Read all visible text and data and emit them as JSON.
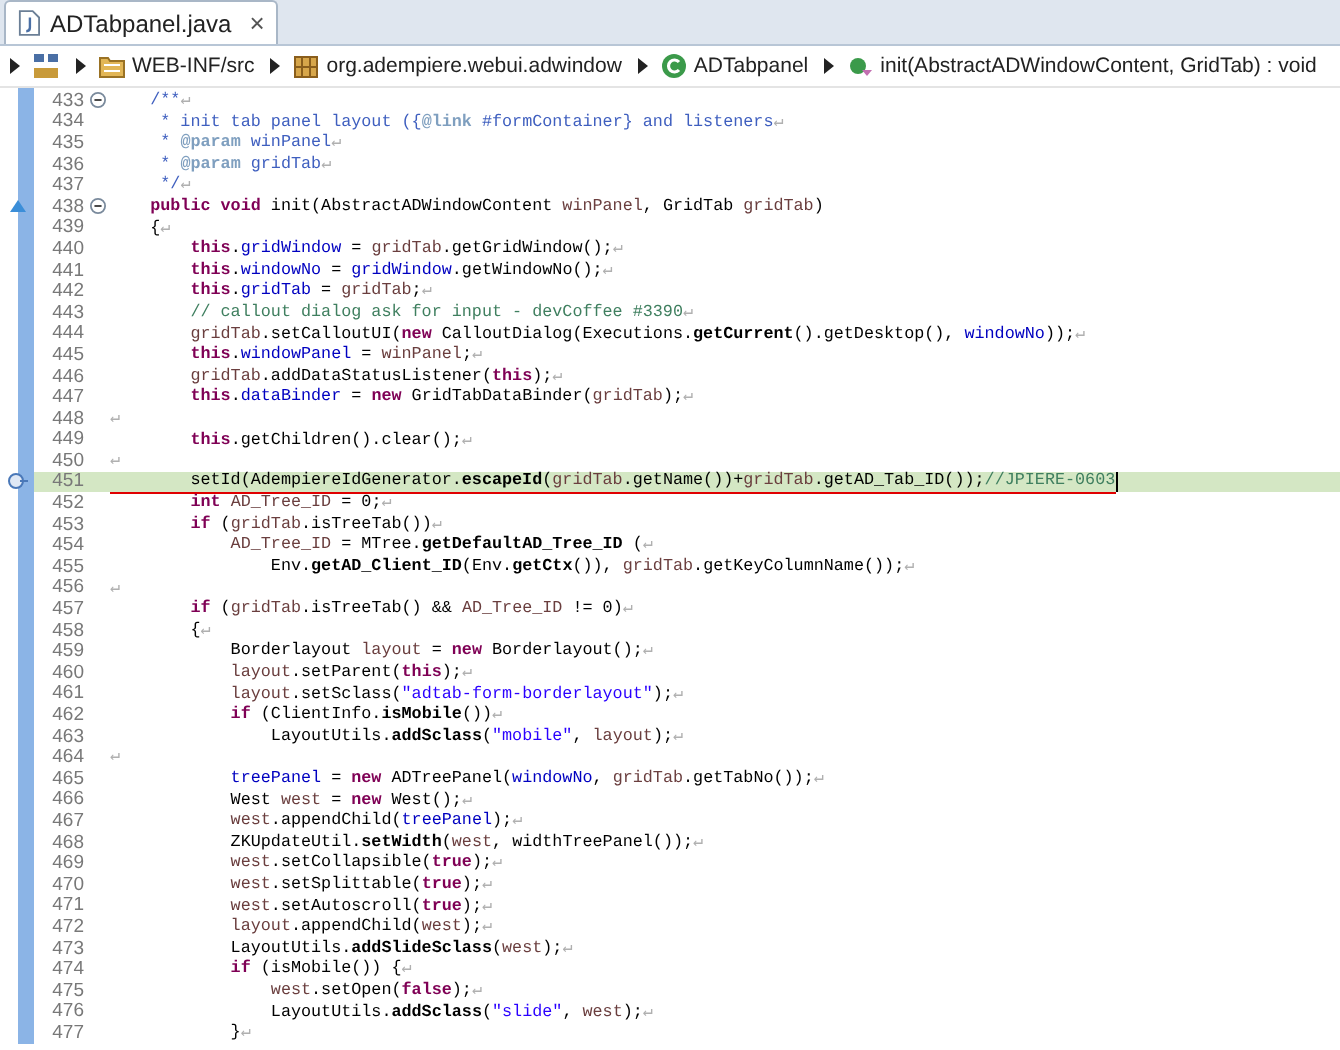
{
  "tab": {
    "title": "ADTabpanel.java",
    "close": "×",
    "selected": true
  },
  "breadcrumb": [
    {
      "kind": "project"
    },
    {
      "kind": "source-folder",
      "label": "WEB-INF/src"
    },
    {
      "kind": "package",
      "label": "org.adempiere.webui.adwindow"
    },
    {
      "kind": "class",
      "label": "ADTabpanel"
    },
    {
      "kind": "method",
      "label": "init(AbstractADWindowContent, GridTab) : void"
    }
  ],
  "eol_mark": "↵",
  "lines": [
    {
      "no": "433",
      "kind": "code",
      "collapsible": true,
      "current": false,
      "eol": true,
      "code": [
        {
          "text": "    /**",
          "kind": "doc"
        }
      ]
    },
    {
      "no": "434",
      "kind": "code",
      "collapsible": false,
      "current": false,
      "eol": true,
      "code": [
        {
          "text": "     * init tab panel layout ({",
          "kind": "doc"
        },
        {
          "text": "@link",
          "kind": "doctag"
        },
        {
          "text": " #formContainer} and listeners",
          "kind": "doc"
        }
      ]
    },
    {
      "no": "435",
      "kind": "code",
      "collapsible": false,
      "current": false,
      "eol": true,
      "code": [
        {
          "text": "     * ",
          "kind": "doc"
        },
        {
          "text": "@param",
          "kind": "doctag"
        },
        {
          "text": " winPanel",
          "kind": "doc"
        }
      ]
    },
    {
      "no": "436",
      "kind": "code",
      "collapsible": false,
      "current": false,
      "eol": true,
      "code": [
        {
          "text": "     * ",
          "kind": "doc"
        },
        {
          "text": "@param",
          "kind": "doctag"
        },
        {
          "text": " gridTab",
          "kind": "doc"
        }
      ]
    },
    {
      "no": "437",
      "kind": "code",
      "collapsible": false,
      "current": false,
      "eol": true,
      "code": [
        {
          "text": "     */",
          "kind": "doc"
        }
      ]
    },
    {
      "no": "438",
      "kind": "override",
      "collapsible": true,
      "current": false,
      "eol": false,
      "code": [
        {
          "text": "    public void",
          "kind": "keyword"
        },
        {
          "text": " init(AbstractADWindowContent ",
          "kind": "plain"
        },
        {
          "text": "winPanel",
          "kind": "local"
        },
        {
          "text": ", GridTab ",
          "kind": "plain"
        },
        {
          "text": "gridTab",
          "kind": "local"
        },
        {
          "text": ")",
          "kind": "plain"
        }
      ]
    },
    {
      "no": "439",
      "kind": "code",
      "collapsible": false,
      "current": false,
      "eol": true,
      "code": [
        {
          "text": "    {",
          "kind": "plain"
        }
      ]
    },
    {
      "no": "440",
      "kind": "code",
      "collapsible": false,
      "current": false,
      "eol": true,
      "code": [
        {
          "text": "        this",
          "kind": "keyword"
        },
        {
          "text": ".",
          "kind": "plain"
        },
        {
          "text": "gridWindow",
          "kind": "field"
        },
        {
          "text": " = ",
          "kind": "plain"
        },
        {
          "text": "gridTab",
          "kind": "local"
        },
        {
          "text": ".getGridWindow();",
          "kind": "plain"
        }
      ]
    },
    {
      "no": "441",
      "kind": "code",
      "collapsible": false,
      "current": false,
      "eol": true,
      "code": [
        {
          "text": "        this",
          "kind": "keyword"
        },
        {
          "text": ".",
          "kind": "plain"
        },
        {
          "text": "windowNo",
          "kind": "field"
        },
        {
          "text": " = ",
          "kind": "plain"
        },
        {
          "text": "gridWindow",
          "kind": "field"
        },
        {
          "text": ".getWindowNo();",
          "kind": "plain"
        }
      ]
    },
    {
      "no": "442",
      "kind": "code",
      "collapsible": false,
      "current": false,
      "eol": true,
      "code": [
        {
          "text": "        this",
          "kind": "keyword"
        },
        {
          "text": ".",
          "kind": "plain"
        },
        {
          "text": "gridTab",
          "kind": "field"
        },
        {
          "text": " = ",
          "kind": "plain"
        },
        {
          "text": "gridTab",
          "kind": "local"
        },
        {
          "text": ";",
          "kind": "plain"
        }
      ]
    },
    {
      "no": "443",
      "kind": "code",
      "collapsible": false,
      "current": false,
      "eol": true,
      "code": [
        {
          "text": "        // callout dialog ask for input - devCoffee #3390",
          "kind": "comment"
        }
      ]
    },
    {
      "no": "444",
      "kind": "code",
      "collapsible": false,
      "current": false,
      "eol": true,
      "code": [
        {
          "text": "        gridTab",
          "kind": "local"
        },
        {
          "text": ".setCalloutUI(",
          "kind": "plain"
        },
        {
          "text": "new",
          "kind": "keyword"
        },
        {
          "text": " CalloutDialog(Executions.",
          "kind": "plain"
        },
        {
          "text": "getCurrent",
          "kind": "static"
        },
        {
          "text": "().getDesktop(), ",
          "kind": "plain"
        },
        {
          "text": "windowNo",
          "kind": "field"
        },
        {
          "text": "));",
          "kind": "plain"
        }
      ]
    },
    {
      "no": "445",
      "kind": "code",
      "collapsible": false,
      "current": false,
      "eol": true,
      "code": [
        {
          "text": "        this",
          "kind": "keyword"
        },
        {
          "text": ".",
          "kind": "plain"
        },
        {
          "text": "windowPanel",
          "kind": "field"
        },
        {
          "text": " = ",
          "kind": "plain"
        },
        {
          "text": "winPanel",
          "kind": "local"
        },
        {
          "text": ";",
          "kind": "plain"
        }
      ]
    },
    {
      "no": "446",
      "kind": "code",
      "collapsible": false,
      "current": false,
      "eol": true,
      "code": [
        {
          "text": "        gridTab",
          "kind": "local"
        },
        {
          "text": ".addDataStatusListener(",
          "kind": "plain"
        },
        {
          "text": "this",
          "kind": "keyword"
        },
        {
          "text": ");",
          "kind": "plain"
        }
      ]
    },
    {
      "no": "447",
      "kind": "code",
      "collapsible": false,
      "current": false,
      "eol": true,
      "code": [
        {
          "text": "        this",
          "kind": "keyword"
        },
        {
          "text": ".",
          "kind": "plain"
        },
        {
          "text": "dataBinder",
          "kind": "field"
        },
        {
          "text": " = ",
          "kind": "plain"
        },
        {
          "text": "new",
          "kind": "keyword"
        },
        {
          "text": " GridTabDataBinder(",
          "kind": "plain"
        },
        {
          "text": "gridTab",
          "kind": "local"
        },
        {
          "text": ");",
          "kind": "plain"
        }
      ]
    },
    {
      "no": "448",
      "kind": "code",
      "collapsible": false,
      "current": false,
      "eol": true
    },
    {
      "no": "449",
      "kind": "code",
      "collapsible": false,
      "current": false,
      "eol": true,
      "code": [
        {
          "text": "        this",
          "kind": "keyword"
        },
        {
          "text": ".getChildren().clear();",
          "kind": "plain"
        }
      ]
    },
    {
      "no": "450",
      "kind": "code",
      "collapsible": false,
      "current": false,
      "eol": true
    },
    {
      "no": "451",
      "kind": "marker",
      "collapsible": false,
      "current": true,
      "eol": false,
      "code": [
        {
          "text": "        setId(AdempiereIdGenerator.",
          "kind": "plain"
        },
        {
          "text": "escapeId",
          "kind": "static"
        },
        {
          "text": "(",
          "kind": "plain"
        },
        {
          "text": "gridTab",
          "kind": "local"
        },
        {
          "text": ".getName())+",
          "kind": "plain"
        },
        {
          "text": "gridTab",
          "kind": "local"
        },
        {
          "text": ".getAD_Tab_ID());",
          "kind": "plain"
        },
        {
          "text": "//JPIERE-0603",
          "kind": "comment"
        }
      ]
    },
    {
      "no": "452",
      "kind": "code",
      "collapsible": false,
      "current": false,
      "eol": true,
      "code": [
        {
          "text": "        int",
          "kind": "keyword"
        },
        {
          "text": " AD_Tree_ID",
          "kind": "local"
        },
        {
          "text": " = 0;",
          "kind": "plain"
        }
      ]
    },
    {
      "no": "453",
      "kind": "code",
      "collapsible": false,
      "current": false,
      "eol": true,
      "code": [
        {
          "text": "        if",
          "kind": "keyword"
        },
        {
          "text": " (",
          "kind": "plain"
        },
        {
          "text": "gridTab",
          "kind": "local"
        },
        {
          "text": ".isTreeTab())",
          "kind": "plain"
        }
      ]
    },
    {
      "no": "454",
      "kind": "code",
      "collapsible": false,
      "current": false,
      "eol": true,
      "code": [
        {
          "text": "            AD_Tree_ID",
          "kind": "local"
        },
        {
          "text": " = MTree.",
          "kind": "plain"
        },
        {
          "text": "getDefaultAD_Tree_ID",
          "kind": "static"
        },
        {
          "text": " (",
          "kind": "plain"
        }
      ]
    },
    {
      "no": "455",
      "kind": "code",
      "collapsible": false,
      "current": false,
      "eol": true,
      "code": [
        {
          "text": "                Env.",
          "kind": "plain"
        },
        {
          "text": "getAD_Client_ID",
          "kind": "static"
        },
        {
          "text": "(Env.",
          "kind": "plain"
        },
        {
          "text": "getCtx",
          "kind": "static"
        },
        {
          "text": "()), ",
          "kind": "plain"
        },
        {
          "text": "gridTab",
          "kind": "local"
        },
        {
          "text": ".getKeyColumnName());",
          "kind": "plain"
        }
      ]
    },
    {
      "no": "456",
      "kind": "code",
      "collapsible": false,
      "current": false,
      "eol": true
    },
    {
      "no": "457",
      "kind": "code",
      "collapsible": false,
      "current": false,
      "eol": true,
      "code": [
        {
          "text": "        if",
          "kind": "keyword"
        },
        {
          "text": " (",
          "kind": "plain"
        },
        {
          "text": "gridTab",
          "kind": "local"
        },
        {
          "text": ".isTreeTab() && ",
          "kind": "plain"
        },
        {
          "text": "AD_Tree_ID",
          "kind": "local"
        },
        {
          "text": " != 0)",
          "kind": "plain"
        }
      ]
    },
    {
      "no": "458",
      "kind": "code",
      "collapsible": false,
      "current": false,
      "eol": true,
      "code": [
        {
          "text": "        {",
          "kind": "plain"
        }
      ]
    },
    {
      "no": "459",
      "kind": "code",
      "collapsible": false,
      "current": false,
      "eol": true,
      "code": [
        {
          "text": "            Borderlayout ",
          "kind": "plain"
        },
        {
          "text": "layout",
          "kind": "local"
        },
        {
          "text": " = ",
          "kind": "plain"
        },
        {
          "text": "new",
          "kind": "keyword"
        },
        {
          "text": " Borderlayout();",
          "kind": "plain"
        }
      ]
    },
    {
      "no": "460",
      "kind": "code",
      "collapsible": false,
      "current": false,
      "eol": true,
      "code": [
        {
          "text": "            layout",
          "kind": "local"
        },
        {
          "text": ".setParent(",
          "kind": "plain"
        },
        {
          "text": "this",
          "kind": "keyword"
        },
        {
          "text": ");",
          "kind": "plain"
        }
      ]
    },
    {
      "no": "461",
      "kind": "code",
      "collapsible": false,
      "current": false,
      "eol": true,
      "code": [
        {
          "text": "            layout",
          "kind": "local"
        },
        {
          "text": ".setSclass(",
          "kind": "plain"
        },
        {
          "text": "\"adtab-form-borderlayout\"",
          "kind": "string"
        },
        {
          "text": ");",
          "kind": "plain"
        }
      ]
    },
    {
      "no": "462",
      "kind": "code",
      "collapsible": false,
      "current": false,
      "eol": true,
      "code": [
        {
          "text": "            if",
          "kind": "keyword"
        },
        {
          "text": " (ClientInfo.",
          "kind": "plain"
        },
        {
          "text": "isMobile",
          "kind": "static"
        },
        {
          "text": "())",
          "kind": "plain"
        }
      ]
    },
    {
      "no": "463",
      "kind": "code",
      "collapsible": false,
      "current": false,
      "eol": true,
      "code": [
        {
          "text": "                LayoutUtils.",
          "kind": "plain"
        },
        {
          "text": "addSclass",
          "kind": "static"
        },
        {
          "text": "(",
          "kind": "plain"
        },
        {
          "text": "\"mobile\"",
          "kind": "string"
        },
        {
          "text": ", ",
          "kind": "plain"
        },
        {
          "text": "layout",
          "kind": "local"
        },
        {
          "text": ");",
          "kind": "plain"
        }
      ]
    },
    {
      "no": "464",
      "kind": "code",
      "collapsible": false,
      "current": false,
      "eol": true
    },
    {
      "no": "465",
      "kind": "code",
      "collapsible": false,
      "current": false,
      "eol": true,
      "code": [
        {
          "text": "            treePanel",
          "kind": "field"
        },
        {
          "text": " = ",
          "kind": "plain"
        },
        {
          "text": "new",
          "kind": "keyword"
        },
        {
          "text": " ADTreePanel(",
          "kind": "plain"
        },
        {
          "text": "windowNo",
          "kind": "field"
        },
        {
          "text": ", ",
          "kind": "plain"
        },
        {
          "text": "gridTab",
          "kind": "local"
        },
        {
          "text": ".getTabNo());",
          "kind": "plain"
        }
      ]
    },
    {
      "no": "466",
      "kind": "code",
      "collapsible": false,
      "current": false,
      "eol": true,
      "code": [
        {
          "text": "            West ",
          "kind": "plain"
        },
        {
          "text": "west",
          "kind": "local"
        },
        {
          "text": " = ",
          "kind": "plain"
        },
        {
          "text": "new",
          "kind": "keyword"
        },
        {
          "text": " West();",
          "kind": "plain"
        }
      ]
    },
    {
      "no": "467",
      "kind": "code",
      "collapsible": false,
      "current": false,
      "eol": true,
      "code": [
        {
          "text": "            west",
          "kind": "local"
        },
        {
          "text": ".appendChild(",
          "kind": "plain"
        },
        {
          "text": "treePanel",
          "kind": "field"
        },
        {
          "text": ");",
          "kind": "plain"
        }
      ]
    },
    {
      "no": "468",
      "kind": "code",
      "collapsible": false,
      "current": false,
      "eol": true,
      "code": [
        {
          "text": "            ZKUpdateUtil.",
          "kind": "plain"
        },
        {
          "text": "setWidth",
          "kind": "static"
        },
        {
          "text": "(",
          "kind": "plain"
        },
        {
          "text": "west",
          "kind": "local"
        },
        {
          "text": ", widthTreePanel());",
          "kind": "plain"
        }
      ]
    },
    {
      "no": "469",
      "kind": "code",
      "collapsible": false,
      "current": false,
      "eol": true,
      "code": [
        {
          "text": "            west",
          "kind": "local"
        },
        {
          "text": ".setCollapsible(",
          "kind": "plain"
        },
        {
          "text": "true",
          "kind": "keyword"
        },
        {
          "text": ");",
          "kind": "plain"
        }
      ]
    },
    {
      "no": "470",
      "kind": "code",
      "collapsible": false,
      "current": false,
      "eol": true,
      "code": [
        {
          "text": "            west",
          "kind": "local"
        },
        {
          "text": ".setSplittable(",
          "kind": "plain"
        },
        {
          "text": "true",
          "kind": "keyword"
        },
        {
          "text": ");",
          "kind": "plain"
        }
      ]
    },
    {
      "no": "471",
      "kind": "code",
      "collapsible": false,
      "current": false,
      "eol": true,
      "code": [
        {
          "text": "            west",
          "kind": "local"
        },
        {
          "text": ".setAutoscroll(",
          "kind": "plain"
        },
        {
          "text": "true",
          "kind": "keyword"
        },
        {
          "text": ");",
          "kind": "plain"
        }
      ]
    },
    {
      "no": "472",
      "kind": "code",
      "collapsible": false,
      "current": false,
      "eol": true,
      "code": [
        {
          "text": "            layout",
          "kind": "local"
        },
        {
          "text": ".appendChild(",
          "kind": "plain"
        },
        {
          "text": "west",
          "kind": "local"
        },
        {
          "text": ");",
          "kind": "plain"
        }
      ]
    },
    {
      "no": "473",
      "kind": "code",
      "collapsible": false,
      "current": false,
      "eol": true,
      "code": [
        {
          "text": "            LayoutUtils.",
          "kind": "plain"
        },
        {
          "text": "addSlideSclass",
          "kind": "static"
        },
        {
          "text": "(",
          "kind": "plain"
        },
        {
          "text": "west",
          "kind": "local"
        },
        {
          "text": ");",
          "kind": "plain"
        }
      ]
    },
    {
      "no": "474",
      "kind": "code",
      "collapsible": false,
      "current": false,
      "eol": true,
      "code": [
        {
          "text": "            if",
          "kind": "keyword"
        },
        {
          "text": " (isMobile()) {",
          "kind": "plain"
        }
      ]
    },
    {
      "no": "475",
      "kind": "code",
      "collapsible": false,
      "current": false,
      "eol": true,
      "code": [
        {
          "text": "                west",
          "kind": "local"
        },
        {
          "text": ".setOpen(",
          "kind": "plain"
        },
        {
          "text": "false",
          "kind": "keyword"
        },
        {
          "text": ");",
          "kind": "plain"
        }
      ]
    },
    {
      "no": "476",
      "kind": "code",
      "collapsible": false,
      "current": false,
      "eol": true,
      "code": [
        {
          "text": "                LayoutUtils.",
          "kind": "plain"
        },
        {
          "text": "addSclass",
          "kind": "static"
        },
        {
          "text": "(",
          "kind": "plain"
        },
        {
          "text": "\"slide\"",
          "kind": "string"
        },
        {
          "text": ", ",
          "kind": "plain"
        },
        {
          "text": "west",
          "kind": "local"
        },
        {
          "text": ");",
          "kind": "plain"
        }
      ]
    },
    {
      "no": "477",
      "kind": "code",
      "collapsible": false,
      "current": false,
      "eol": true,
      "code": [
        {
          "text": "            }",
          "kind": "plain"
        }
      ]
    }
  ]
}
